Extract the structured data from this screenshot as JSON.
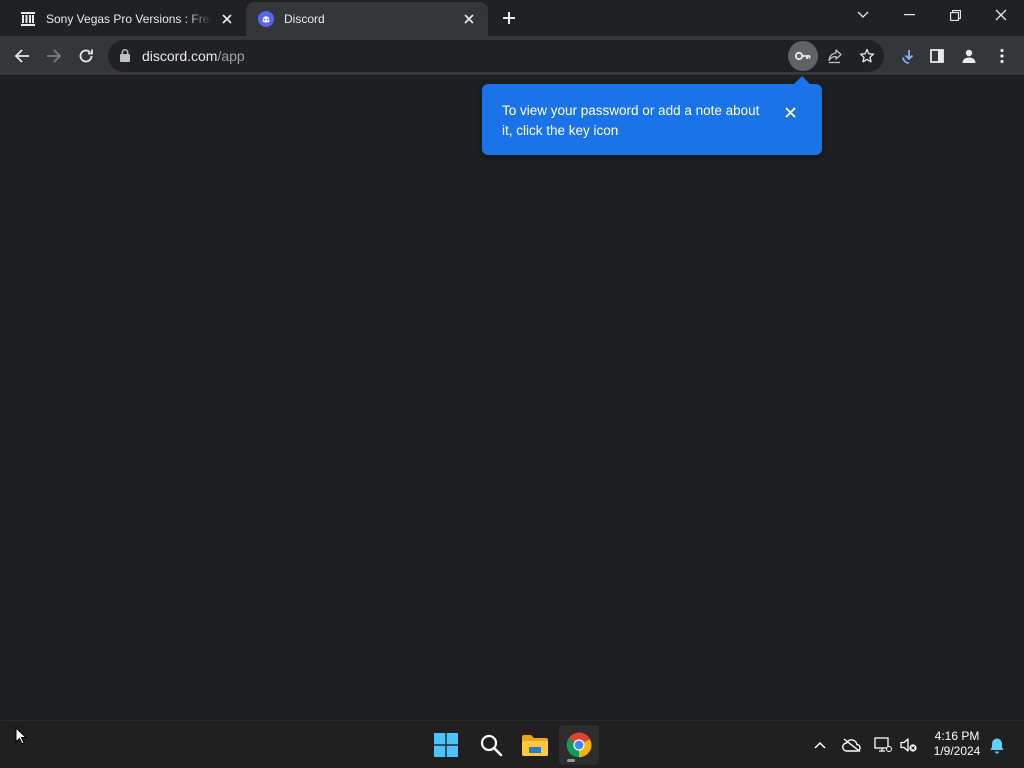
{
  "tabs": [
    {
      "title": "Sony Vegas Pro Versions : Free Download, Borrow",
      "favicon": "archive-org-icon",
      "active": false
    },
    {
      "title": "Discord",
      "favicon": "discord-icon",
      "active": true
    }
  ],
  "omnibox": {
    "url_host": "discord.com",
    "url_path": "/app"
  },
  "bubble": {
    "text": "To view your password or add a note about it, click the key icon"
  },
  "clock": {
    "time": "4:16 PM",
    "date": "1/9/2024"
  },
  "colors": {
    "accent_blue": "#1a73e8",
    "discord": "#5865f2",
    "content_bg": "#1e1f22"
  }
}
